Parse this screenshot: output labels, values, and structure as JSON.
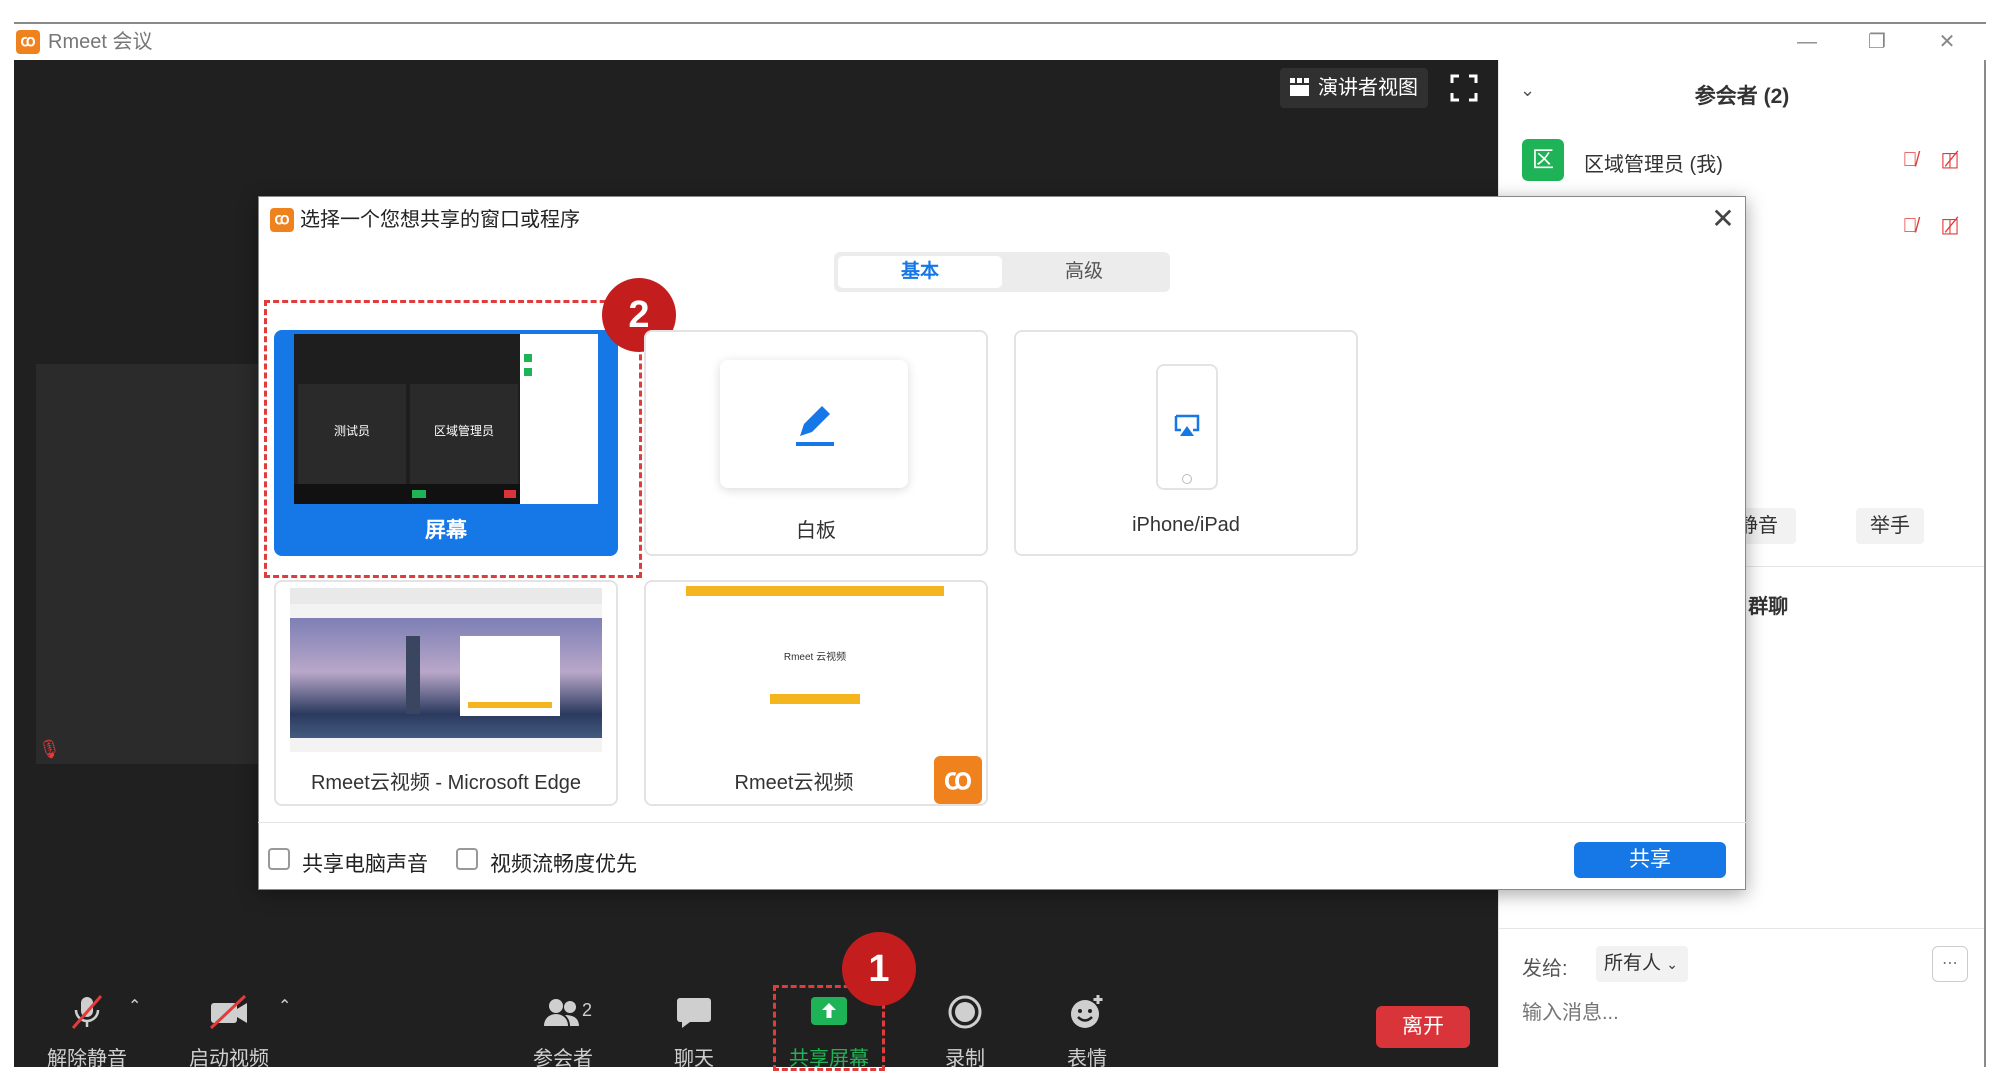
{
  "app": {
    "title": "Rmeet 会议"
  },
  "top": {
    "speaker_view": "演讲者视图"
  },
  "toolbar": {
    "mute": "解除静音",
    "video": "启动视频",
    "participants": "参会者",
    "participants_count": "2",
    "chat": "聊天",
    "share_screen": "共享屏幕",
    "record": "录制",
    "reactions": "表情",
    "leave": "离开"
  },
  "panel": {
    "title": "参会者 (2)",
    "participant_avatar": "区",
    "participant_name": "区域管理员 (我)",
    "mute_btn": "静音",
    "raise_hand_btn": "举手",
    "chat_title": ": 群聊",
    "send_to_label": "发给:",
    "send_to_value": "所有人",
    "message_placeholder": "输入消息..."
  },
  "dialog": {
    "title": "选择一个您想共享的窗口或程序",
    "tabs": [
      "基本",
      "高级"
    ],
    "options": [
      "屏幕",
      "白板",
      "iPhone/iPad"
    ],
    "windows": [
      "Rmeet云视频 - Microsoft Edge",
      "Rmeet云视频"
    ],
    "checkbox_audio": "共享电脑声音",
    "checkbox_fluency": "视频流畅度优先",
    "share_button": "共享"
  },
  "thumb": {
    "tester": "测试员",
    "admin": "区域管理员",
    "login_title": "Rmeet 云视频"
  },
  "callouts": [
    "1",
    "2"
  ],
  "colors": {
    "accent": "#1677e6",
    "leave": "#d9343a",
    "share_green": "#1fb357",
    "callout": "#c41d1d",
    "brand_orange": "#f0821e"
  }
}
